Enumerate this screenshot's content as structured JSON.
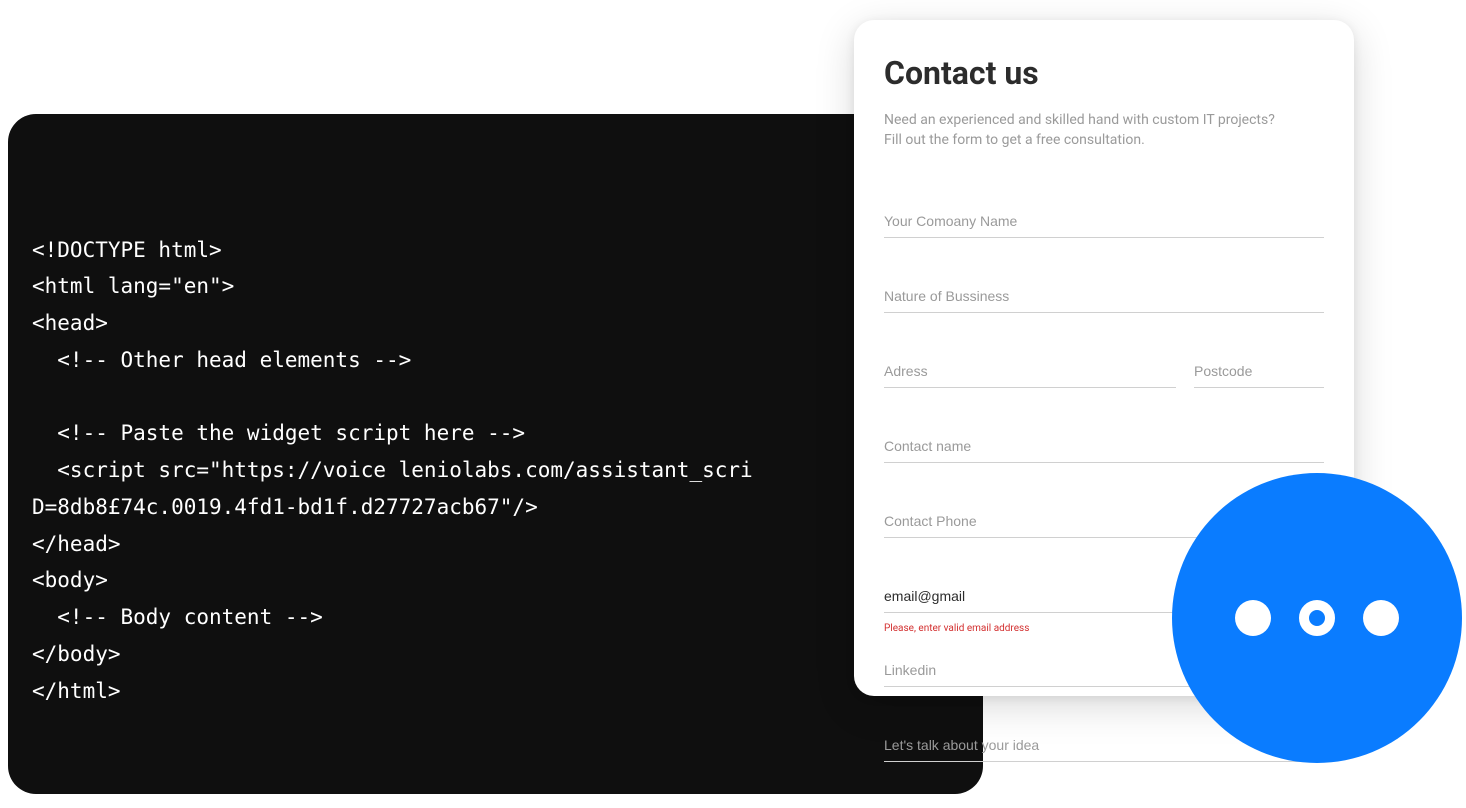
{
  "code": {
    "lines": [
      "<!DOCTYPE html>",
      "<html lang=\"en\">",
      "<head>",
      "  <!-- Other head elements -->",
      "",
      "  <!-- Paste the widget script here -->",
      "  <script src=\"https://voice leniolabs.com/assistant_scri",
      "D=8db8£74c.0019.4fd1-bd1f.d27727acb67\"/>",
      "</head>",
      "<body>",
      "  <!-- Body content -->",
      "</body>",
      "</html>"
    ]
  },
  "form": {
    "title": "Contact us",
    "subtitle_line1": "Need an experienced and skilled hand with custom IT projects?",
    "subtitle_line2": "Fill out the form to get a free consultation.",
    "fields": {
      "company": {
        "placeholder": "Your Comoany Name",
        "value": ""
      },
      "nature": {
        "placeholder": "Nature of Bussiness",
        "value": ""
      },
      "address": {
        "placeholder": "Adress",
        "value": ""
      },
      "postcode": {
        "placeholder": "Postcode",
        "value": ""
      },
      "contact_name": {
        "placeholder": "Contact name",
        "value": ""
      },
      "contact_phone": {
        "placeholder": "Contact Phone",
        "value": ""
      },
      "email": {
        "placeholder": "",
        "value": "email@gmail",
        "error": "Please, enter valid email address"
      },
      "linkedin": {
        "placeholder": "Linkedin",
        "value": ""
      },
      "idea": {
        "placeholder": "Let's talk about your idea",
        "value": ""
      }
    }
  },
  "fab": {
    "icon": "more-dots"
  }
}
